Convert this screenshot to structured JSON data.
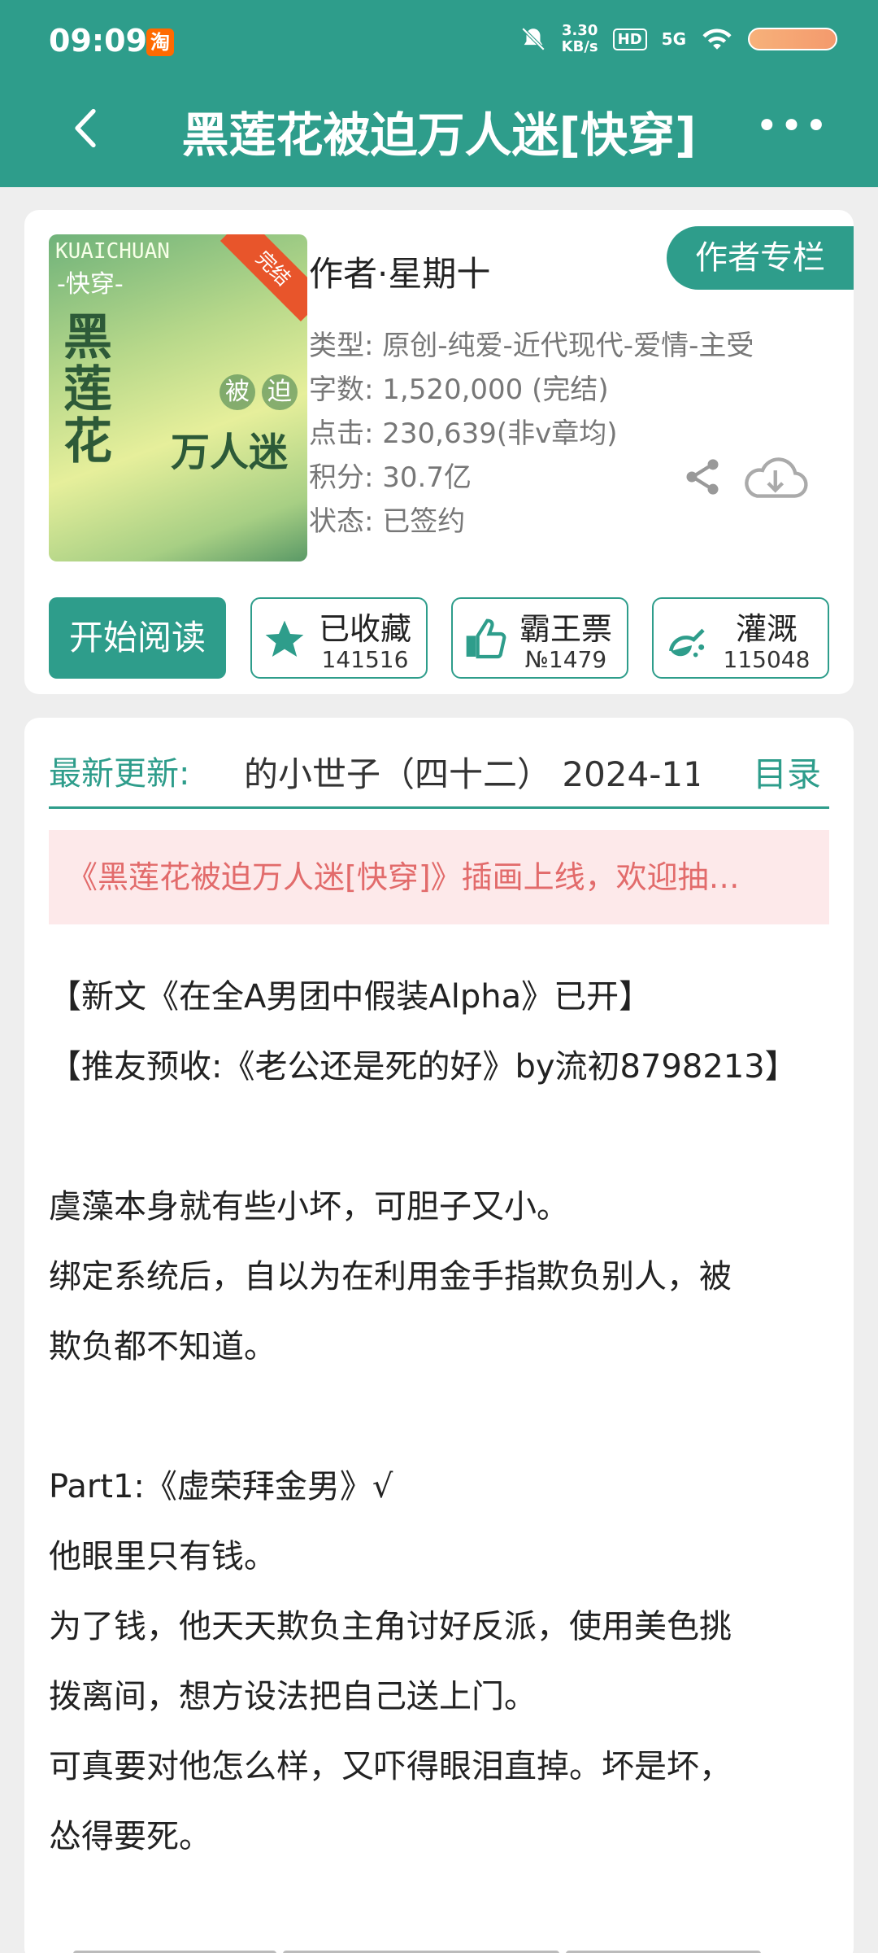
{
  "status_bar": {
    "time": "09:09",
    "app_icon": "淘",
    "net_speed_value": "3.30",
    "net_speed_unit": "KB/s",
    "hd": "HD",
    "signal": "5G"
  },
  "header": {
    "title": "黑莲花被迫万人迷[快穿]",
    "more": "•••"
  },
  "book": {
    "cover": {
      "ribbon": "完结",
      "brand": "KUAICHUAN",
      "sub": "-快穿-",
      "title_vertical": "黑莲花",
      "title_a": "被",
      "title_b": "迫",
      "title_c": "万人迷"
    },
    "author": "作者·星期十",
    "author_column_button": "作者专栏",
    "type": "类型: 原创-纯爱-近代现代-爱情-主受",
    "words": "字数: 1,520,000 (完结)",
    "clicks": "点击: 230,639(非v章均)",
    "score": "积分: 30.7亿",
    "state": "状态: 已签约"
  },
  "actions": {
    "read": "开始阅读",
    "favorite_label": "已收藏",
    "favorite_count": "141516",
    "bawang_label": "霸王票",
    "bawang_count": "№1479",
    "water_label": "灌溉",
    "water_count": "115048"
  },
  "content": {
    "latest_label": "最新更新:",
    "latest_text": "的小世子（四十二） 2024-11",
    "catalog": "目录",
    "notice": "《黑莲花被迫万人迷[快穿]》插画上线，欢迎抽…",
    "lines": [
      "【新文《在全A男团中假装Alpha》已开】",
      "【推友预收:《老公还是死的好》by流初8798213】",
      "",
      "虞藻本身就有些小坏，可胆子又小。",
      "绑定系统后，自以为在利用金手指欺负别人，被",
      "欺负都不知道。",
      "",
      "Part1:《虚荣拜金男》√",
      "他眼里只有钱。",
      "为了钱，他天天欺负主角讨好反派，使用美色挑",
      "拨离间，想方设法把自己送上门。",
      "可真要对他怎么样，又吓得眼泪直掉。坏是坏，",
      "怂得要死。"
    ]
  },
  "colors": {
    "brand": "#2e9d8b",
    "notice_bg": "#fde9ea",
    "notice_text": "#e26b6b"
  }
}
